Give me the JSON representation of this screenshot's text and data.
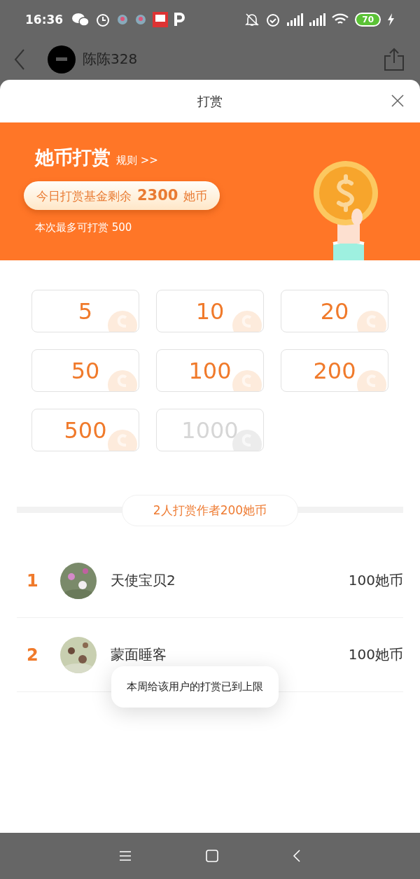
{
  "status_bar": {
    "time": "16:36",
    "battery": "70"
  },
  "nav": {
    "username": "陈陈328"
  },
  "sheet": {
    "title": "打赏"
  },
  "banner": {
    "title": "她币打赏",
    "rules_link": "规则 >>",
    "fund_label": "今日打赏基金剩余",
    "fund_amount": "2300",
    "fund_unit": "她币",
    "limit_text": "本次最多可打赏 500"
  },
  "amounts": [
    {
      "label": "5",
      "disabled": false
    },
    {
      "label": "10",
      "disabled": false
    },
    {
      "label": "20",
      "disabled": false
    },
    {
      "label": "50",
      "disabled": false
    },
    {
      "label": "100",
      "disabled": false
    },
    {
      "label": "200",
      "disabled": false
    },
    {
      "label": "500",
      "disabled": false
    },
    {
      "label": "1000",
      "disabled": true
    }
  ],
  "summary": "2人打赏作者200她币",
  "rewarders": [
    {
      "rank": "1",
      "name": "天使宝贝2",
      "amount": "100她币"
    },
    {
      "rank": "2",
      "name": "蒙面睡客",
      "amount": "100她币"
    }
  ],
  "toast": "本周给该用户的打赏已到上限"
}
